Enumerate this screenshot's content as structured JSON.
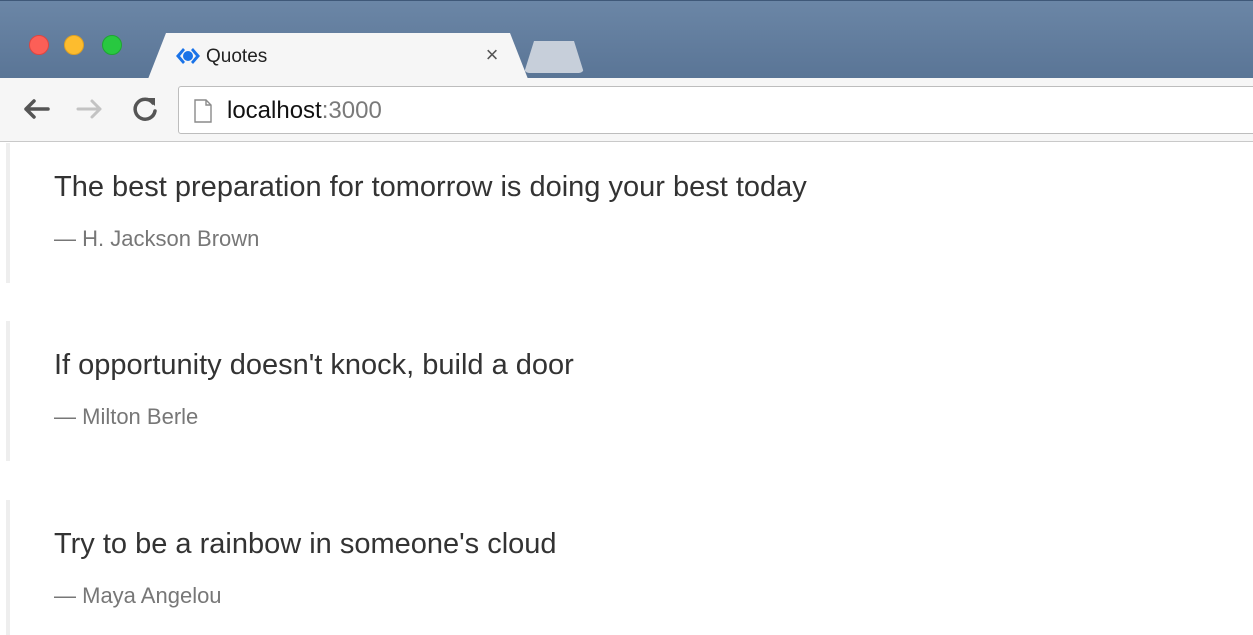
{
  "browser": {
    "tab": {
      "title": "Quotes",
      "close_glyph": "×",
      "favicon": "react-logo-icon"
    },
    "address": {
      "host": "localhost",
      "port": ":3000"
    },
    "icons": {
      "back": "back-arrow-icon",
      "forward": "forward-arrow-icon",
      "reload": "reload-icon",
      "page": "page-icon"
    },
    "colors": {
      "titlebar": "#5a7596",
      "close": "#fc5f57",
      "minimize": "#fdbc2e",
      "maximize": "#28c840",
      "favicon": "#1a73e8"
    }
  },
  "quotes": [
    {
      "text": "The best preparation for tomorrow is doing your best today",
      "author": "— H. Jackson Brown"
    },
    {
      "text": "If opportunity doesn't knock, build a door",
      "author": "— Milton Berle"
    },
    {
      "text": "Try to be a rainbow in someone's cloud",
      "author": "— Maya Angelou"
    }
  ]
}
